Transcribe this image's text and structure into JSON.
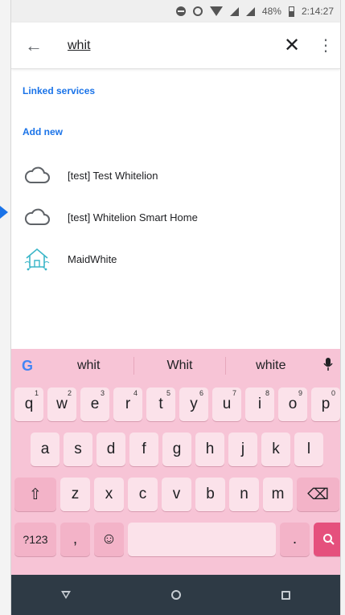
{
  "status_bar": {
    "battery_percent": "48%",
    "time": "2:14:27",
    "icons": [
      "do-not-disturb-icon",
      "alarm-icon",
      "wifi-icon",
      "signal-icon",
      "signal-icon",
      "battery-icon"
    ]
  },
  "search": {
    "value": "whit",
    "back_icon": "←",
    "clear_icon": "✕",
    "menu_icon": "⋮"
  },
  "sections": {
    "linked_services": "Linked services",
    "add_new": "Add new"
  },
  "results": [
    {
      "label": "[test] Test Whitelion",
      "icon": "cloud-icon"
    },
    {
      "label": "[test] Whitelion Smart Home",
      "icon": "cloud-icon"
    },
    {
      "label": "MaidWhite",
      "icon": "smart-home-icon"
    }
  ],
  "keyboard": {
    "google_logo": "G",
    "suggestions": [
      "whit",
      "Whit",
      "white"
    ],
    "mic_icon": "🎤",
    "row1": [
      "q",
      "w",
      "e",
      "r",
      "t",
      "y",
      "u",
      "i",
      "o",
      "p"
    ],
    "row1_hints": [
      "1",
      "2",
      "3",
      "4",
      "5",
      "6",
      "7",
      "8",
      "9",
      "0"
    ],
    "row2": [
      "a",
      "s",
      "d",
      "f",
      "g",
      "h",
      "j",
      "k",
      "l"
    ],
    "row3": [
      "z",
      "x",
      "c",
      "v",
      "b",
      "n",
      "m"
    ],
    "shift_icon": "⇧",
    "backspace_icon": "⌫",
    "symbols_label": "?123",
    "comma": ",",
    "emoji_icon": "☺",
    "period": ".",
    "search_icon": "🔍"
  },
  "nav": {
    "back_icon": "back-icon",
    "home_icon": "home-icon",
    "recents_icon": "recents-icon"
  },
  "colors": {
    "accent": "#1a73e8",
    "keyboard_bg": "#f7c4d6",
    "key_bg": "#fbe2ea",
    "action_key": "#e5507d",
    "nav_bg": "#2e3a45",
    "pointer": "#1a73e8"
  }
}
